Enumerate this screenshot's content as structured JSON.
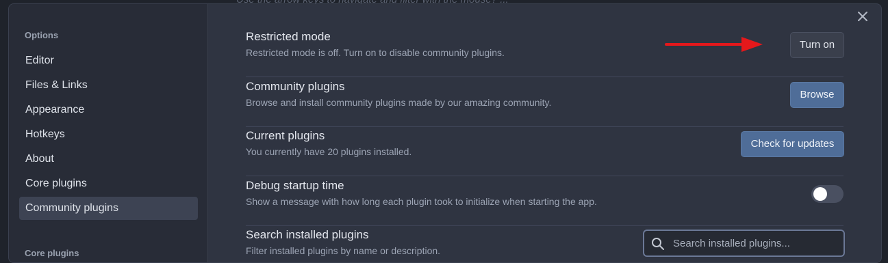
{
  "backdrop": {
    "text": "Use the arrow keys to navigate and filter with the mouse? ..."
  },
  "sidebar": {
    "heading_options": "Options",
    "items": [
      {
        "label": "Editor"
      },
      {
        "label": "Files & Links"
      },
      {
        "label": "Appearance"
      },
      {
        "label": "Hotkeys"
      },
      {
        "label": "About"
      },
      {
        "label": "Core plugins"
      },
      {
        "label": "Community plugins",
        "active": true
      }
    ],
    "heading_core": "Core plugins"
  },
  "main": {
    "settings": [
      {
        "name": "Restricted mode",
        "description": "Restricted mode is off. Turn on to disable community plugins.",
        "button": "Turn on"
      },
      {
        "name": "Community plugins",
        "description": "Browse and install community plugins made by our amazing community.",
        "button": "Browse"
      },
      {
        "name": "Current plugins",
        "description": "You currently have 20 plugins installed.",
        "button": "Check for updates"
      },
      {
        "name": "Debug startup time",
        "description": "Show a message with how long each plugin took to initialize when starting the app.",
        "toggle": false
      },
      {
        "name": "Search installed plugins",
        "description": "Filter installed plugins by name or description.",
        "search_placeholder": "Search installed plugins...",
        "search_value": ""
      }
    ]
  },
  "colors": {
    "accent_button": "#4f6d98",
    "annotation_arrow": "#e5181b"
  },
  "icons": {
    "close": "close-icon",
    "search": "search-icon",
    "arrow": "red-arrow-annotation"
  }
}
